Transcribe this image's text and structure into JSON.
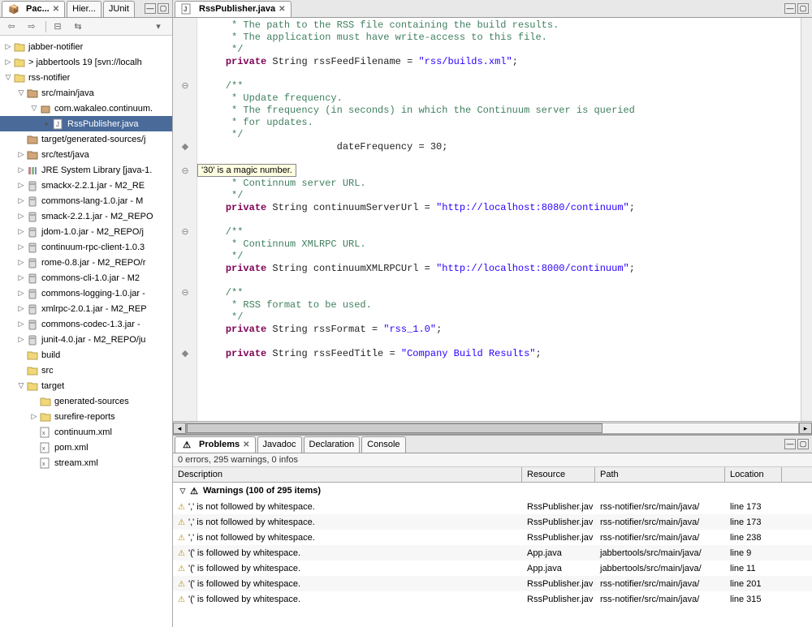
{
  "sidebar": {
    "tabs": [
      "Pac...",
      "Hier...",
      "JUnit"
    ],
    "tree": [
      {
        "d": 0,
        "tw": "▷",
        "ic": "project",
        "label": "jabber-notifier"
      },
      {
        "d": 0,
        "tw": "▷",
        "ic": "project",
        "label": "> jabbertools 19 [svn://localh"
      },
      {
        "d": 0,
        "tw": "▽",
        "ic": "project",
        "label": "rss-notifier"
      },
      {
        "d": 1,
        "tw": "▽",
        "ic": "srcfolder",
        "label": "src/main/java"
      },
      {
        "d": 2,
        "tw": "▽",
        "ic": "package",
        "label": "com.wakaleo.continuum."
      },
      {
        "d": 3,
        "tw": "▸",
        "ic": "jfile",
        "label": "RssPublisher.java",
        "sel": true
      },
      {
        "d": 1,
        "tw": "",
        "ic": "srcfolder",
        "label": "target/generated-sources/j"
      },
      {
        "d": 1,
        "tw": "▷",
        "ic": "srcfolder",
        "label": "src/test/java"
      },
      {
        "d": 1,
        "tw": "▷",
        "ic": "lib",
        "label": "JRE System Library [java-1."
      },
      {
        "d": 1,
        "tw": "▷",
        "ic": "jar",
        "label": "smackx-2.2.1.jar - M2_RE"
      },
      {
        "d": 1,
        "tw": "▷",
        "ic": "jar",
        "label": "commons-lang-1.0.jar - M"
      },
      {
        "d": 1,
        "tw": "▷",
        "ic": "jar",
        "label": "smack-2.2.1.jar - M2_REPO"
      },
      {
        "d": 1,
        "tw": "▷",
        "ic": "jar",
        "label": "jdom-1.0.jar - M2_REPO/j"
      },
      {
        "d": 1,
        "tw": "▷",
        "ic": "jar",
        "label": "continuum-rpc-client-1.0.3"
      },
      {
        "d": 1,
        "tw": "▷",
        "ic": "jar",
        "label": "rome-0.8.jar - M2_REPO/r"
      },
      {
        "d": 1,
        "tw": "▷",
        "ic": "jar",
        "label": "commons-cli-1.0.jar - M2"
      },
      {
        "d": 1,
        "tw": "▷",
        "ic": "jar",
        "label": "commons-logging-1.0.jar -"
      },
      {
        "d": 1,
        "tw": "▷",
        "ic": "jar",
        "label": "xmlrpc-2.0.1.jar - M2_REP"
      },
      {
        "d": 1,
        "tw": "▷",
        "ic": "jar",
        "label": "commons-codec-1.3.jar -"
      },
      {
        "d": 1,
        "tw": "▷",
        "ic": "jar",
        "label": "junit-4.0.jar - M2_REPO/ju"
      },
      {
        "d": 1,
        "tw": "",
        "ic": "folder",
        "label": "build"
      },
      {
        "d": 1,
        "tw": "",
        "ic": "folder",
        "label": "src"
      },
      {
        "d": 1,
        "tw": "▽",
        "ic": "folder",
        "label": "target"
      },
      {
        "d": 2,
        "tw": "",
        "ic": "folder",
        "label": "generated-sources"
      },
      {
        "d": 2,
        "tw": "▷",
        "ic": "folder",
        "label": "surefire-reports"
      },
      {
        "d": 2,
        "tw": "",
        "ic": "xfile",
        "label": "continuum.xml"
      },
      {
        "d": 2,
        "tw": "",
        "ic": "xfile",
        "label": "pom.xml"
      },
      {
        "d": 2,
        "tw": "",
        "ic": "xfile",
        "label": "stream.xml"
      }
    ]
  },
  "editor": {
    "tab_title": "RssPublisher.java",
    "tab_icon": "jfile",
    "annotation_tip": "'30' is a magic number.",
    "code_lines": [
      {
        "t": "     * The path to the RSS file containing the build results.",
        "c": "cm"
      },
      {
        "t": "     * The application must have write-access to this file.",
        "c": "cm"
      },
      {
        "t": "     */",
        "c": "cm"
      },
      {
        "t": "    private String rssFeedFilename = \"rss/builds.xml\";",
        "c": "code",
        "parts": [
          {
            "t": "    "
          },
          {
            "t": "private",
            "c": "kw"
          },
          {
            "t": " String rssFeedFilename = "
          },
          {
            "t": "\"rss/builds.xml\"",
            "c": "str"
          },
          {
            "t": ";"
          }
        ]
      },
      {
        "t": ""
      },
      {
        "t": "    /**",
        "c": "cm"
      },
      {
        "t": "     * Update frequency.",
        "c": "cm"
      },
      {
        "t": "     * The frequency (in seconds) in which the Continuum server is queried",
        "c": "cm"
      },
      {
        "t": "     * for updates.",
        "c": "cm"
      },
      {
        "t": "     */",
        "c": "cm"
      },
      {
        "t": "                       dateFrequency = 30;",
        "c": "code",
        "parts": [
          {
            "t": "                       dateFrequency = 30;"
          }
        ]
      },
      {
        "t": ""
      },
      {
        "t": "    /**",
        "c": "cm"
      },
      {
        "t": "     * Continnum server URL.",
        "c": "cm"
      },
      {
        "t": "     */",
        "c": "cm"
      },
      {
        "t": "    private String continuumServerUrl = \"http://localhost:8080/continuum\";",
        "c": "code",
        "parts": [
          {
            "t": "    "
          },
          {
            "t": "private",
            "c": "kw"
          },
          {
            "t": " String continuumServerUrl = "
          },
          {
            "t": "\"http://localhost:8080/continuum\"",
            "c": "str"
          },
          {
            "t": ";"
          }
        ]
      },
      {
        "t": ""
      },
      {
        "t": "    /**",
        "c": "cm"
      },
      {
        "t": "     * Continnum XMLRPC URL.",
        "c": "cm"
      },
      {
        "t": "     */",
        "c": "cm"
      },
      {
        "t": "    private String continuumXMLRPCUrl = \"http://localhost:8000/continuum\";",
        "c": "code",
        "parts": [
          {
            "t": "    "
          },
          {
            "t": "private",
            "c": "kw"
          },
          {
            "t": " String continuumXMLRPCUrl = "
          },
          {
            "t": "\"http://localhost:8000/continuum\"",
            "c": "str"
          },
          {
            "t": ";"
          }
        ]
      },
      {
        "t": ""
      },
      {
        "t": "    /**",
        "c": "cm"
      },
      {
        "t": "     * RSS format to be used.",
        "c": "cm"
      },
      {
        "t": "     */",
        "c": "cm"
      },
      {
        "t": "    private String rssFormat = \"rss_1.0\";",
        "c": "code",
        "parts": [
          {
            "t": "    "
          },
          {
            "t": "private",
            "c": "kw"
          },
          {
            "t": " String rssFormat = "
          },
          {
            "t": "\"rss_1.0\"",
            "c": "str"
          },
          {
            "t": ";"
          }
        ]
      },
      {
        "t": ""
      },
      {
        "t": "    private String rssFeedTitle = \"Company Build Results\";",
        "c": "code",
        "parts": [
          {
            "t": "    "
          },
          {
            "t": "private",
            "c": "kw"
          },
          {
            "t": " String rssFeedTitle = "
          },
          {
            "t": "\"Company Build Results\"",
            "c": "str"
          },
          {
            "t": ";"
          }
        ]
      }
    ],
    "gutter_marks": [
      {
        "line": 5,
        "sym": "⊖"
      },
      {
        "line": 10,
        "sym": "◆"
      },
      {
        "line": 12,
        "sym": "⊖"
      },
      {
        "line": 17,
        "sym": "⊖"
      },
      {
        "line": 22,
        "sym": "⊖"
      },
      {
        "line": 27,
        "sym": "◆"
      }
    ]
  },
  "problems": {
    "tabs": [
      "Problems",
      "Javadoc",
      "Declaration",
      "Console"
    ],
    "status": "0 errors, 295 warnings, 0 infos",
    "columns": [
      "Description",
      "Resource",
      "Path",
      "Location"
    ],
    "group_label": "Warnings (100 of 295 items)",
    "items": [
      {
        "desc": "',' is not followed by whitespace.",
        "res": "RssPublisher.jav",
        "path": "rss-notifier/src/main/java/",
        "loc": "line 173"
      },
      {
        "desc": "',' is not followed by whitespace.",
        "res": "RssPublisher.jav",
        "path": "rss-notifier/src/main/java/",
        "loc": "line 173"
      },
      {
        "desc": "',' is not followed by whitespace.",
        "res": "RssPublisher.jav",
        "path": "rss-notifier/src/main/java/",
        "loc": "line 238"
      },
      {
        "desc": "'(' is followed by whitespace.",
        "res": "App.java",
        "path": "jabbertools/src/main/java/",
        "loc": "line 9"
      },
      {
        "desc": "'(' is followed by whitespace.",
        "res": "App.java",
        "path": "jabbertools/src/main/java/",
        "loc": "line 11"
      },
      {
        "desc": "'(' is followed by whitespace.",
        "res": "RssPublisher.jav",
        "path": "rss-notifier/src/main/java/",
        "loc": "line 201"
      },
      {
        "desc": "'(' is followed by whitespace.",
        "res": "RssPublisher.jav",
        "path": "rss-notifier/src/main/java/",
        "loc": "line 315"
      }
    ]
  }
}
